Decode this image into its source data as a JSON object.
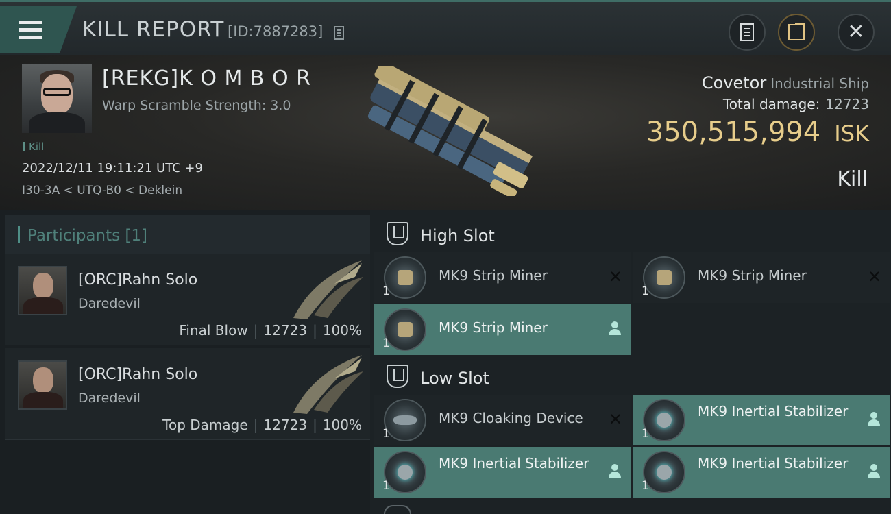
{
  "header": {
    "title": "KILL REPORT",
    "report_id": "[ID:7887283]"
  },
  "victim": {
    "name": "[REKG]K O M B O R",
    "stat": "Warp Scramble Strength: 3.0",
    "tag": "Kill",
    "datetime": "2022/12/11 19:11:21 UTC +9",
    "location": "I30-3A < UTQ-B0 < Deklein",
    "ship": "Covetor",
    "ship_class": "Industrial Ship",
    "damage_label": "Total damage:",
    "damage_value": "12723",
    "isk_value": "350,515,994",
    "isk_unit": "ISK",
    "result": "Kill"
  },
  "participants": {
    "title": "Participants [1]",
    "rows": [
      {
        "name": "[ORC]Rahn Solo",
        "ship": "Daredevil",
        "role": "Final Blow",
        "damage": "12723",
        "percent": "100%"
      },
      {
        "name": "[ORC]Rahn Solo",
        "ship": "Daredevil",
        "role": "Top Damage",
        "damage": "12723",
        "percent": "100%"
      }
    ]
  },
  "slots": {
    "high": {
      "title": "High Slot",
      "modules": [
        {
          "name": "MK9 Strip Miner",
          "qty": "1",
          "state": "destroyed"
        },
        {
          "name": "MK9 Strip Miner",
          "qty": "1",
          "state": "destroyed"
        },
        {
          "name": "MK9 Strip Miner",
          "qty": "1",
          "state": "dropped"
        }
      ]
    },
    "low": {
      "title": "Low Slot",
      "modules": [
        {
          "name": "MK9 Cloaking Device",
          "qty": "1",
          "state": "destroyed"
        },
        {
          "name": "MK9 Inertial Stabilizer",
          "qty": "1",
          "state": "dropped"
        },
        {
          "name": "MK9 Inertial Stabilizer",
          "qty": "1",
          "state": "dropped"
        },
        {
          "name": "MK9 Inertial Stabilizer",
          "qty": "1",
          "state": "dropped"
        }
      ]
    }
  },
  "colors": {
    "accent_teal": "#4a7a72",
    "isk_gold": "#e7cd8b"
  }
}
